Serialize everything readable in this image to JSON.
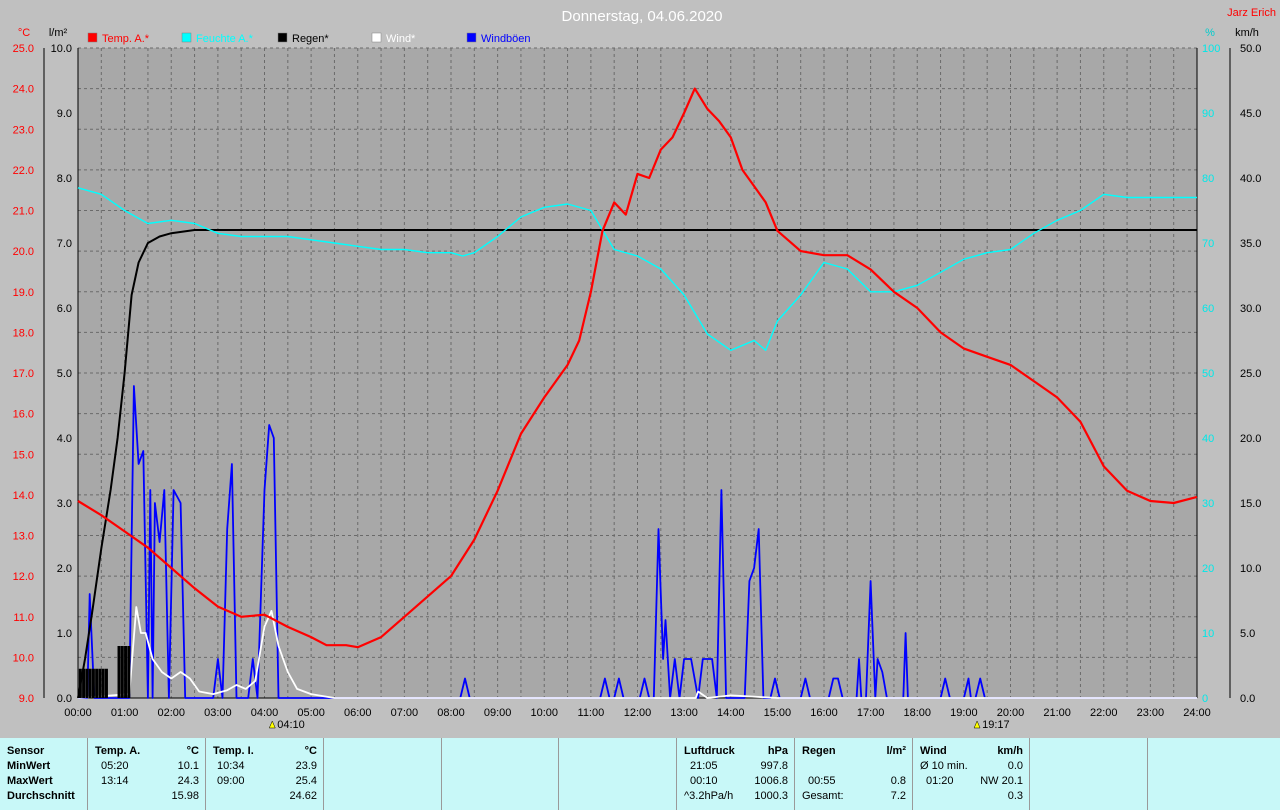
{
  "title": "Donnerstag, 04.06.2020",
  "author": "Jarz Erich",
  "axes": {
    "left1_unit": "°C",
    "left2_unit": "l/m²",
    "right1_unit": "%",
    "right2_unit": "km/h"
  },
  "legend": [
    {
      "label": "Temp. A.*",
      "color": "#ff0000"
    },
    {
      "label": "Feuchte A.*",
      "color": "#00ffff"
    },
    {
      "label": "Regen*",
      "color": "#000000"
    },
    {
      "label": "Wind*",
      "color": "#ffffff"
    },
    {
      "label": "Windböen",
      "color": "#0000ff"
    }
  ],
  "sun_markers": [
    {
      "time": "04:10"
    },
    {
      "time": "19:17"
    }
  ],
  "chart_data": {
    "type": "line",
    "x_range": [
      "00:00",
      "24:00"
    ],
    "x_ticks": [
      "00:00",
      "01:00",
      "02:00",
      "03:00",
      "04:00",
      "05:00",
      "06:00",
      "07:00",
      "08:00",
      "09:00",
      "10:00",
      "11:00",
      "12:00",
      "13:00",
      "14:00",
      "15:00",
      "16:00",
      "17:00",
      "18:00",
      "19:00",
      "20:00",
      "21:00",
      "22:00",
      "23:00",
      "24:00"
    ],
    "y_axes": {
      "temperature": {
        "unit": "°C",
        "range": [
          9.0,
          25.0
        ],
        "ticks": [
          "25.0",
          "24.0",
          "23.0",
          "22.0",
          "21.0",
          "20.0",
          "19.0",
          "18.0",
          "17.0",
          "16.0",
          "15.0",
          "14.0",
          "13.0",
          "12.0",
          "11.0",
          "10.0",
          "9.0"
        ]
      },
      "rain": {
        "unit": "l/m²",
        "range": [
          0.0,
          10.0
        ],
        "ticks": [
          "10.0",
          "9.0",
          "8.0",
          "7.0",
          "6.0",
          "5.0",
          "4.0",
          "3.0",
          "2.0",
          "1.0",
          "0.0"
        ]
      },
      "humidity": {
        "unit": "%",
        "range": [
          0,
          100
        ],
        "ticks": [
          "100",
          "90",
          "80",
          "70",
          "60",
          "50",
          "40",
          "30",
          "20",
          "10",
          "0"
        ]
      },
      "wind": {
        "unit": "km/h",
        "range": [
          0.0,
          50.0
        ],
        "ticks": [
          "50.0",
          "45.0",
          "40.0",
          "35.0",
          "30.0",
          "25.0",
          "20.0",
          "15.0",
          "10.0",
          "5.0",
          "0.0"
        ]
      }
    },
    "grid": true,
    "series": [
      {
        "name": "Temp. A.*",
        "axis": "temperature",
        "color": "#ff0000",
        "points": [
          [
            0.0,
            13.85
          ],
          [
            0.5,
            13.5
          ],
          [
            1.0,
            13.1
          ],
          [
            1.5,
            12.7
          ],
          [
            2.0,
            12.2
          ],
          [
            2.5,
            11.7
          ],
          [
            3.0,
            11.25
          ],
          [
            3.5,
            11.0
          ],
          [
            4.0,
            11.05
          ],
          [
            4.5,
            10.75
          ],
          [
            5.0,
            10.5
          ],
          [
            5.33,
            10.3
          ],
          [
            5.75,
            10.3
          ],
          [
            6.0,
            10.25
          ],
          [
            6.5,
            10.5
          ],
          [
            7.0,
            11.0
          ],
          [
            7.5,
            11.5
          ],
          [
            8.0,
            12.0
          ],
          [
            8.5,
            12.9
          ],
          [
            9.0,
            14.1
          ],
          [
            9.5,
            15.5
          ],
          [
            10.0,
            16.4
          ],
          [
            10.5,
            17.2
          ],
          [
            10.75,
            17.8
          ],
          [
            11.0,
            19.0
          ],
          [
            11.25,
            20.5
          ],
          [
            11.5,
            21.2
          ],
          [
            11.75,
            20.9
          ],
          [
            12.0,
            21.9
          ],
          [
            12.25,
            21.8
          ],
          [
            12.5,
            22.5
          ],
          [
            12.75,
            22.8
          ],
          [
            13.0,
            23.4
          ],
          [
            13.23,
            24.0
          ],
          [
            13.5,
            23.5
          ],
          [
            13.75,
            23.2
          ],
          [
            14.0,
            22.8
          ],
          [
            14.25,
            22.0
          ],
          [
            14.5,
            21.6
          ],
          [
            14.75,
            21.2
          ],
          [
            15.0,
            20.5
          ],
          [
            15.5,
            20.0
          ],
          [
            16.0,
            19.9
          ],
          [
            16.5,
            19.9
          ],
          [
            17.0,
            19.55
          ],
          [
            17.5,
            19.0
          ],
          [
            18.0,
            18.6
          ],
          [
            18.5,
            18.0
          ],
          [
            19.0,
            17.6
          ],
          [
            19.5,
            17.4
          ],
          [
            20.0,
            17.2
          ],
          [
            20.5,
            16.8
          ],
          [
            21.0,
            16.4
          ],
          [
            21.5,
            15.8
          ],
          [
            22.0,
            14.7
          ],
          [
            22.5,
            14.1
          ],
          [
            23.0,
            13.85
          ],
          [
            23.5,
            13.8
          ],
          [
            24.0,
            13.95
          ]
        ]
      },
      {
        "name": "Feuchte A.*",
        "axis": "humidity",
        "color": "#00ffff",
        "points": [
          [
            0.0,
            78.5
          ],
          [
            0.5,
            77.5
          ],
          [
            1.0,
            75.0
          ],
          [
            1.5,
            73.0
          ],
          [
            2.0,
            73.5
          ],
          [
            2.5,
            73.0
          ],
          [
            3.0,
            71.5
          ],
          [
            3.5,
            71.0
          ],
          [
            4.0,
            71.0
          ],
          [
            4.5,
            71.0
          ],
          [
            5.0,
            70.5
          ],
          [
            5.5,
            70.0
          ],
          [
            6.0,
            69.5
          ],
          [
            6.5,
            69.0
          ],
          [
            7.0,
            69.0
          ],
          [
            7.5,
            68.5
          ],
          [
            8.0,
            68.5
          ],
          [
            8.25,
            68.0
          ],
          [
            8.5,
            68.5
          ],
          [
            9.0,
            71.0
          ],
          [
            9.5,
            74.0
          ],
          [
            10.0,
            75.5
          ],
          [
            10.5,
            76.0
          ],
          [
            11.0,
            75.0
          ],
          [
            11.25,
            72.0
          ],
          [
            11.5,
            69.0
          ],
          [
            12.0,
            68.0
          ],
          [
            12.5,
            66.0
          ],
          [
            13.0,
            62.0
          ],
          [
            13.5,
            56.0
          ],
          [
            14.0,
            53.5
          ],
          [
            14.5,
            55.0
          ],
          [
            14.75,
            53.5
          ],
          [
            15.0,
            58.0
          ],
          [
            15.5,
            62.0
          ],
          [
            16.0,
            67.0
          ],
          [
            16.5,
            66.0
          ],
          [
            17.0,
            62.5
          ],
          [
            17.5,
            62.5
          ],
          [
            18.0,
            63.5
          ],
          [
            18.5,
            65.5
          ],
          [
            19.0,
            67.5
          ],
          [
            19.5,
            68.5
          ],
          [
            20.0,
            69.0
          ],
          [
            20.5,
            71.5
          ],
          [
            21.0,
            73.5
          ],
          [
            21.5,
            75.0
          ],
          [
            22.0,
            77.5
          ],
          [
            22.5,
            77.0
          ],
          [
            23.0,
            77.0
          ],
          [
            23.5,
            77.0
          ],
          [
            24.0,
            77.0
          ]
        ]
      },
      {
        "name": "Regen*",
        "axis": "rain",
        "color": "#000000",
        "points": [
          [
            0.0,
            0.0
          ],
          [
            0.15,
            0.6
          ],
          [
            0.3,
            1.3
          ],
          [
            0.5,
            2.3
          ],
          [
            0.7,
            3.2
          ],
          [
            0.85,
            4.0
          ],
          [
            1.0,
            5.0
          ],
          [
            1.15,
            6.2
          ],
          [
            1.3,
            6.7
          ],
          [
            1.5,
            7.0
          ],
          [
            1.75,
            7.1
          ],
          [
            2.0,
            7.15
          ],
          [
            2.5,
            7.2
          ],
          [
            24.0,
            7.2
          ]
        ]
      },
      {
        "name": "Wind*",
        "axis": "wind",
        "color": "#ffffff",
        "points": [
          [
            0.0,
            0.0
          ],
          [
            1.1,
            0.3
          ],
          [
            1.25,
            7.0
          ],
          [
            1.35,
            5.0
          ],
          [
            1.45,
            5.0
          ],
          [
            1.6,
            3.0
          ],
          [
            1.8,
            2.0
          ],
          [
            2.0,
            1.5
          ],
          [
            2.2,
            2.0
          ],
          [
            2.4,
            1.5
          ],
          [
            2.6,
            0.5
          ],
          [
            2.9,
            0.3
          ],
          [
            3.2,
            0.6
          ],
          [
            3.4,
            1.0
          ],
          [
            3.6,
            0.7
          ],
          [
            3.8,
            1.3
          ],
          [
            4.0,
            5.5
          ],
          [
            4.15,
            6.7
          ],
          [
            4.3,
            4.0
          ],
          [
            4.5,
            2.0
          ],
          [
            4.7,
            0.7
          ],
          [
            5.0,
            0.3
          ],
          [
            5.5,
            0.0
          ],
          [
            13.25,
            0.0
          ],
          [
            13.3,
            0.5
          ],
          [
            13.5,
            0.0
          ],
          [
            14.0,
            0.2
          ],
          [
            14.5,
            0.1
          ],
          [
            15.0,
            0.0
          ],
          [
            24.0,
            0.0
          ]
        ]
      },
      {
        "name": "Windböen",
        "axis": "wind",
        "color": "#0000ff",
        "points": [
          [
            0.0,
            0.0
          ],
          [
            0.2,
            0.0
          ],
          [
            0.25,
            8.0
          ],
          [
            0.35,
            0.0
          ],
          [
            1.1,
            0.0
          ],
          [
            1.2,
            24.0
          ],
          [
            1.3,
            18.0
          ],
          [
            1.4,
            19.0
          ],
          [
            1.5,
            0.0
          ],
          [
            1.55,
            16.0
          ],
          [
            1.6,
            0.0
          ],
          [
            1.65,
            15.0
          ],
          [
            1.75,
            12.0
          ],
          [
            1.85,
            16.0
          ],
          [
            1.95,
            0.0
          ],
          [
            2.05,
            16.0
          ],
          [
            2.2,
            15.0
          ],
          [
            2.3,
            0.0
          ],
          [
            2.9,
            0.0
          ],
          [
            3.0,
            3.0
          ],
          [
            3.1,
            0.0
          ],
          [
            3.2,
            13.0
          ],
          [
            3.3,
            18.0
          ],
          [
            3.4,
            0.0
          ],
          [
            3.65,
            0.0
          ],
          [
            3.75,
            3.0
          ],
          [
            3.85,
            0.0
          ],
          [
            4.0,
            16.0
          ],
          [
            4.1,
            21.0
          ],
          [
            4.2,
            20.0
          ],
          [
            4.3,
            0.0
          ],
          [
            8.2,
            0.0
          ],
          [
            8.3,
            1.5
          ],
          [
            8.4,
            0.0
          ],
          [
            11.2,
            0.0
          ],
          [
            11.3,
            1.5
          ],
          [
            11.4,
            0.0
          ],
          [
            11.5,
            0.0
          ],
          [
            11.6,
            1.5
          ],
          [
            11.7,
            0.0
          ],
          [
            12.05,
            0.0
          ],
          [
            12.15,
            1.5
          ],
          [
            12.25,
            0.0
          ],
          [
            12.35,
            0.0
          ],
          [
            12.45,
            13.0
          ],
          [
            12.55,
            3.0
          ],
          [
            12.6,
            6.0
          ],
          [
            12.7,
            0.0
          ],
          [
            12.8,
            3.0
          ],
          [
            12.9,
            0.0
          ],
          [
            13.0,
            3.0
          ],
          [
            13.15,
            3.0
          ],
          [
            13.3,
            0.0
          ],
          [
            13.4,
            3.0
          ],
          [
            13.6,
            3.0
          ],
          [
            13.7,
            0.0
          ],
          [
            13.8,
            16.0
          ],
          [
            13.9,
            0.0
          ],
          [
            14.3,
            0.0
          ],
          [
            14.4,
            9.0
          ],
          [
            14.5,
            10.0
          ],
          [
            14.6,
            13.0
          ],
          [
            14.7,
            0.0
          ],
          [
            14.85,
            0.0
          ],
          [
            14.95,
            1.5
          ],
          [
            15.05,
            0.0
          ],
          [
            15.5,
            0.0
          ],
          [
            15.6,
            1.5
          ],
          [
            15.7,
            0.0
          ],
          [
            16.1,
            0.0
          ],
          [
            16.2,
            1.5
          ],
          [
            16.3,
            1.5
          ],
          [
            16.4,
            0.0
          ],
          [
            16.7,
            0.0
          ],
          [
            16.75,
            3.0
          ],
          [
            16.8,
            0.0
          ],
          [
            16.9,
            0.0
          ],
          [
            17.0,
            9.0
          ],
          [
            17.1,
            0.0
          ],
          [
            17.15,
            3.0
          ],
          [
            17.25,
            2.0
          ],
          [
            17.35,
            0.0
          ],
          [
            17.7,
            0.0
          ],
          [
            17.75,
            5.0
          ],
          [
            17.8,
            0.0
          ],
          [
            18.5,
            0.0
          ],
          [
            18.6,
            1.5
          ],
          [
            18.7,
            0.0
          ],
          [
            19.0,
            0.0
          ],
          [
            19.1,
            1.5
          ],
          [
            19.15,
            0.0
          ],
          [
            19.25,
            0.0
          ],
          [
            19.35,
            1.5
          ],
          [
            19.45,
            0.0
          ],
          [
            24.0,
            0.0
          ]
        ]
      }
    ]
  },
  "stats": {
    "sensor": {
      "header": "Sensor",
      "rows": [
        "MinWert",
        "MaxWert",
        "Durchschnitt"
      ]
    },
    "temp_a": {
      "header": "Temp. A.",
      "unit": "°C",
      "rows": [
        {
          "time": "05:20",
          "value": "10.1"
        },
        {
          "time": "13:14",
          "value": "24.3"
        },
        {
          "time": "",
          "value": "15.98"
        }
      ]
    },
    "temp_i": {
      "header": "Temp. I.",
      "unit": "°C",
      "rows": [
        {
          "time": "10:34",
          "value": "23.9"
        },
        {
          "time": "09:00",
          "value": "25.4"
        },
        {
          "time": "",
          "value": "24.62"
        }
      ]
    },
    "pressure": {
      "header": "Luftdruck",
      "unit": "hPa",
      "rows": [
        {
          "time": "21:05",
          "value": "997.8"
        },
        {
          "time": "00:10",
          "value": "1006.8"
        },
        {
          "time": "^3.2hPa/h",
          "value": "1000.3"
        }
      ]
    },
    "rain": {
      "header": "Regen",
      "unit": "l/m²",
      "rows": [
        {
          "time": "",
          "value": ""
        },
        {
          "time": "00:55",
          "value": "0.8"
        },
        {
          "time": "Gesamt:",
          "value": "7.2"
        }
      ]
    },
    "wind": {
      "header": "Wind",
      "unit": "km/h",
      "rows": [
        {
          "time": "Ø 10 min.",
          "value": "0.0"
        },
        {
          "time": "01:20",
          "value": "NW 20.1"
        },
        {
          "time": "",
          "value": "0.3"
        }
      ]
    }
  }
}
